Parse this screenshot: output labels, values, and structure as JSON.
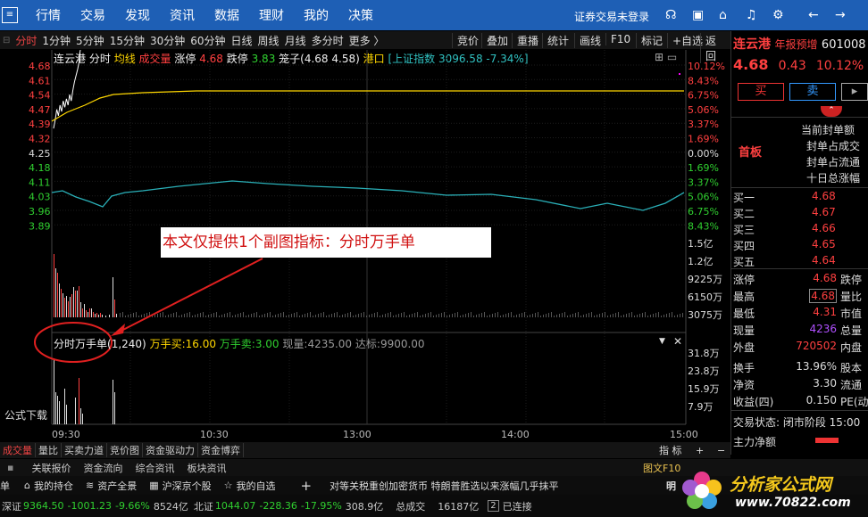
{
  "topbar": {
    "menu_glyph": "≡",
    "nav": [
      "行情",
      "交易",
      "发现",
      "资讯",
      "数据",
      "理财",
      "我的",
      "决策"
    ],
    "login": "证券交易未登录"
  },
  "toolbar": {
    "periods": [
      "分时",
      "1分钟",
      "5分钟",
      "15分钟",
      "30分钟",
      "60分钟",
      "日线",
      "周线",
      "月线",
      "多分时",
      "更多 〉"
    ],
    "right": [
      "竞价",
      "叠加",
      "重播",
      "统计",
      "画线",
      "F10",
      "标记",
      "+自选",
      "返回"
    ]
  },
  "chart_header": {
    "name": "连云港",
    "mode": "分时",
    "avg": "均线",
    "vol": "成交量",
    "zt_label": "涨停",
    "zt": "4.68",
    "dt_label": "跌停",
    "dt": "3.83",
    "cage": "笼子(4.68 4.58)",
    "port": "港口",
    "index": "[上证指数 3096.58 -7.34%]",
    "icons": "⊞ ▭"
  },
  "chart_data": {
    "type": "line",
    "x_ticks": [
      "09:30",
      "10:30",
      "13:00",
      "14:00",
      "15:00"
    ],
    "prev_close": 4.25,
    "price_ticks": [
      "4.68",
      "4.61",
      "4.54",
      "4.47",
      "4.39",
      "4.32",
      "4.25",
      "4.18",
      "4.11",
      "4.03",
      "3.96",
      "3.89"
    ],
    "pct_ticks": [
      "10.12%",
      "8.43%",
      "6.75%",
      "5.06%",
      "3.37%",
      "1.69%",
      "0.00%",
      "1.69%",
      "3.37%",
      "5.06%",
      "6.75%",
      "8.43%"
    ],
    "vol_ticks": [
      "1.5亿",
      "1.2亿",
      "9225万",
      "6150万",
      "3075万"
    ],
    "series": [
      {
        "name": "均线",
        "values": [
          4.33,
          4.42,
          4.55,
          4.62,
          4.64,
          4.64,
          4.64,
          4.64,
          4.64,
          4.64,
          4.64,
          4.64,
          4.64
        ]
      },
      {
        "values": [
          4.09,
          4.08,
          4.05,
          4.04,
          4.06,
          4.05,
          4.06,
          4.05,
          4.03,
          4.02,
          4.0,
          4.02,
          4.05
        ]
      }
    ]
  },
  "annotation": "本文仅提供1个副图指标：分时万手单",
  "sub": {
    "name": "分时万手单",
    "params": "(1,240)",
    "buy_label": "万手买:",
    "buy": "16.00",
    "sell_label": "万手卖:",
    "sell": "3.00",
    "now_label": "现量:",
    "now": "4235.00",
    "reach_label": "达标:",
    "reach": "9900.00",
    "ticks": [
      "31.8万",
      "23.8万",
      "15.9万",
      "7.9万"
    ],
    "caption": "公式下载"
  },
  "bottom_tabs": [
    "成交量",
    "量比",
    "买卖力道",
    "竞价图",
    "资金驱动力",
    "资金博弈"
  ],
  "bottom_right": [
    "指 标",
    "+",
    "−"
  ],
  "right_panel": {
    "name": "连云港",
    "badge": "年报预增",
    "code": "601008",
    "price": "4.68",
    "change": "0.43",
    "pct": "10.12%",
    "buy": "买",
    "sell": "卖",
    "more": "▸",
    "seal_amount": "当前封单额",
    "seal_pct": "封单占成交",
    "seal_float": "封单占流通",
    "ten_day": "十日总涨幅",
    "board": "首板",
    "bids": [
      [
        "买一",
        "4.68"
      ],
      [
        "买二",
        "4.67"
      ],
      [
        "买三",
        "4.66"
      ],
      [
        "买四",
        "4.65"
      ],
      [
        "买五",
        "4.64"
      ]
    ],
    "stats": [
      [
        "涨停",
        "4.68",
        "跌停"
      ],
      [
        "最高",
        "4.68",
        "量比"
      ],
      [
        "最低",
        "4.31",
        "市值"
      ],
      [
        "现量",
        "4236",
        "总量"
      ],
      [
        "外盘",
        "720502",
        "内盘"
      ],
      [
        "换手",
        "13.96%",
        "股本"
      ],
      [
        "净资",
        "3.30",
        "流通"
      ],
      [
        "收益(四)",
        "0.150",
        "PE(动)"
      ]
    ],
    "status": "交易状态: 闭市阶段 15:00",
    "fund": "主力净额"
  },
  "strip1": [
    "关联报价",
    "资金流向",
    "综合资讯",
    "板块资讯"
  ],
  "strip1_right": "图文F10",
  "strip2": [
    "单",
    "我的持仓",
    "资产全景",
    "沪深京个股",
    "我的自选",
    "+"
  ],
  "ticker": "对等关税重创加密货币 特朗普胜选以来涨幅几乎抹平",
  "strip2_right": "明",
  "strip3": {
    "sz_label": "深证",
    "sz": "9364.50",
    "sz_chg": "-1001.23",
    "sz_pct": "-9.66%",
    "sz_amt": "8524亿",
    "bz_label": "北证",
    "bz": "1044.07",
    "bz_chg": "-228.36",
    "bz_pct": "-17.95%",
    "bz_amt": "308.9亿",
    "total_label": "总成交",
    "total": "16187亿",
    "conn": "已连接"
  },
  "watermark": {
    "title": "分析家公式网",
    "url": "www.70822.com"
  }
}
